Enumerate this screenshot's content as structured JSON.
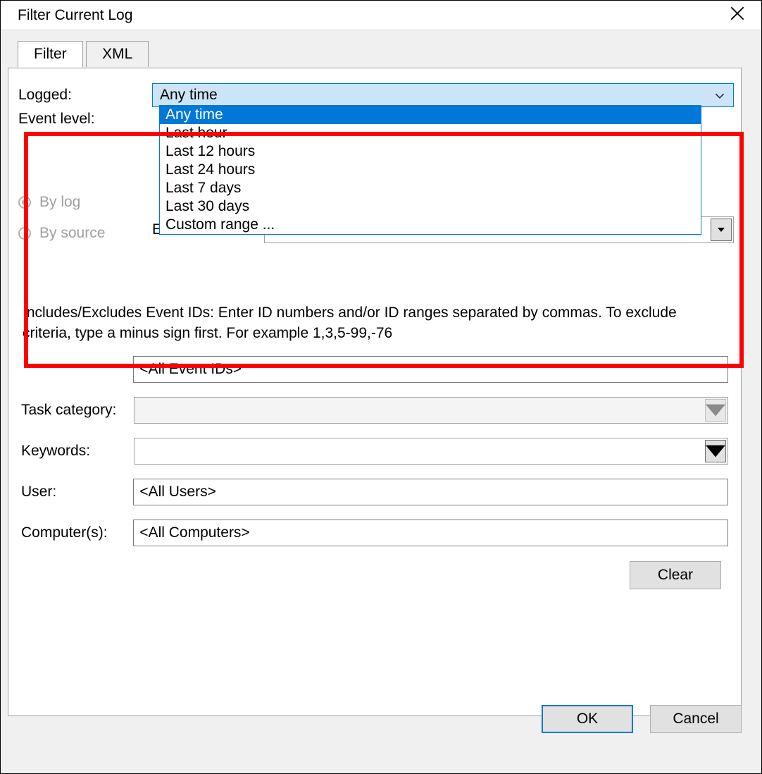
{
  "window": {
    "title": "Filter Current Log"
  },
  "tabs": {
    "filter": "Filter",
    "xml": "XML"
  },
  "labels": {
    "logged": "Logged:",
    "event_level": "Event level:",
    "by_log": "By log",
    "by_source": "By source",
    "event_sources_u": "Event sources:",
    "help": "Includes/Excludes Event IDs: Enter ID numbers and/or ID ranges separated by commas. To exclude criteria, type a minus sign first. For example 1,3,5-99,-76",
    "task_category": "Task category:",
    "keywords": "Keywords:",
    "user": "User:",
    "computers": "Computer(s):"
  },
  "logged_combo": {
    "selected": "Any time",
    "options": [
      "Any time",
      "Last hour",
      "Last 12 hours",
      "Last 24 hours",
      "Last 7 days",
      "Last 30 days",
      "Custom range ..."
    ],
    "selected_index": 0
  },
  "inputs": {
    "event_ids": "<All Event IDs>",
    "user": "<All Users>",
    "computers": "<All Computers>"
  },
  "buttons": {
    "clear": "Clear",
    "ok": "OK",
    "cancel": "Cancel"
  }
}
